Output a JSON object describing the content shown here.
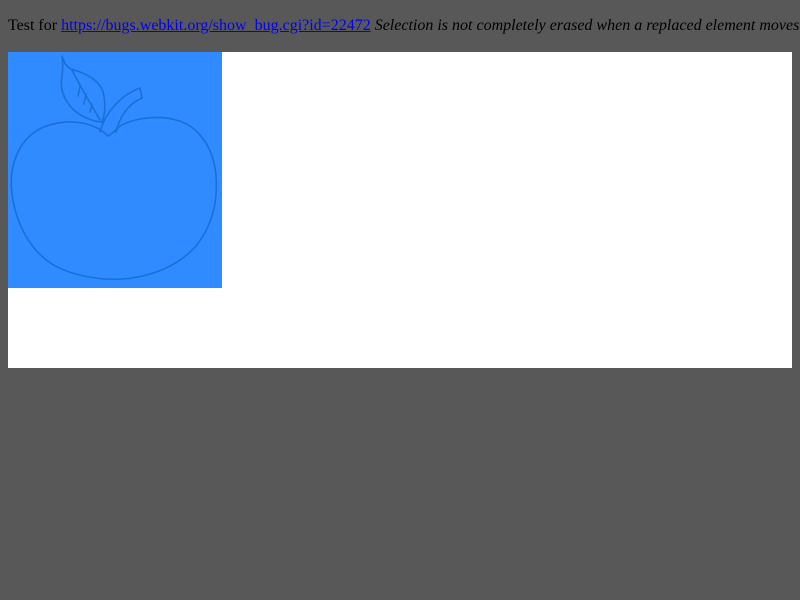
{
  "header": {
    "prefix_text": "Test for ",
    "bug_link_text": "https://bugs.webkit.org/show_bug.cgi?id=22472",
    "space": " ",
    "description": "Selection is not completely erased when a replaced element moves"
  },
  "colors": {
    "page_background": "#585858",
    "container_background": "#ffffff",
    "image_background": "#2f8bff",
    "apple_outline": "#1c6fd6",
    "link": "#0000ee"
  },
  "image": {
    "icon_name": "apple-outline-image"
  }
}
